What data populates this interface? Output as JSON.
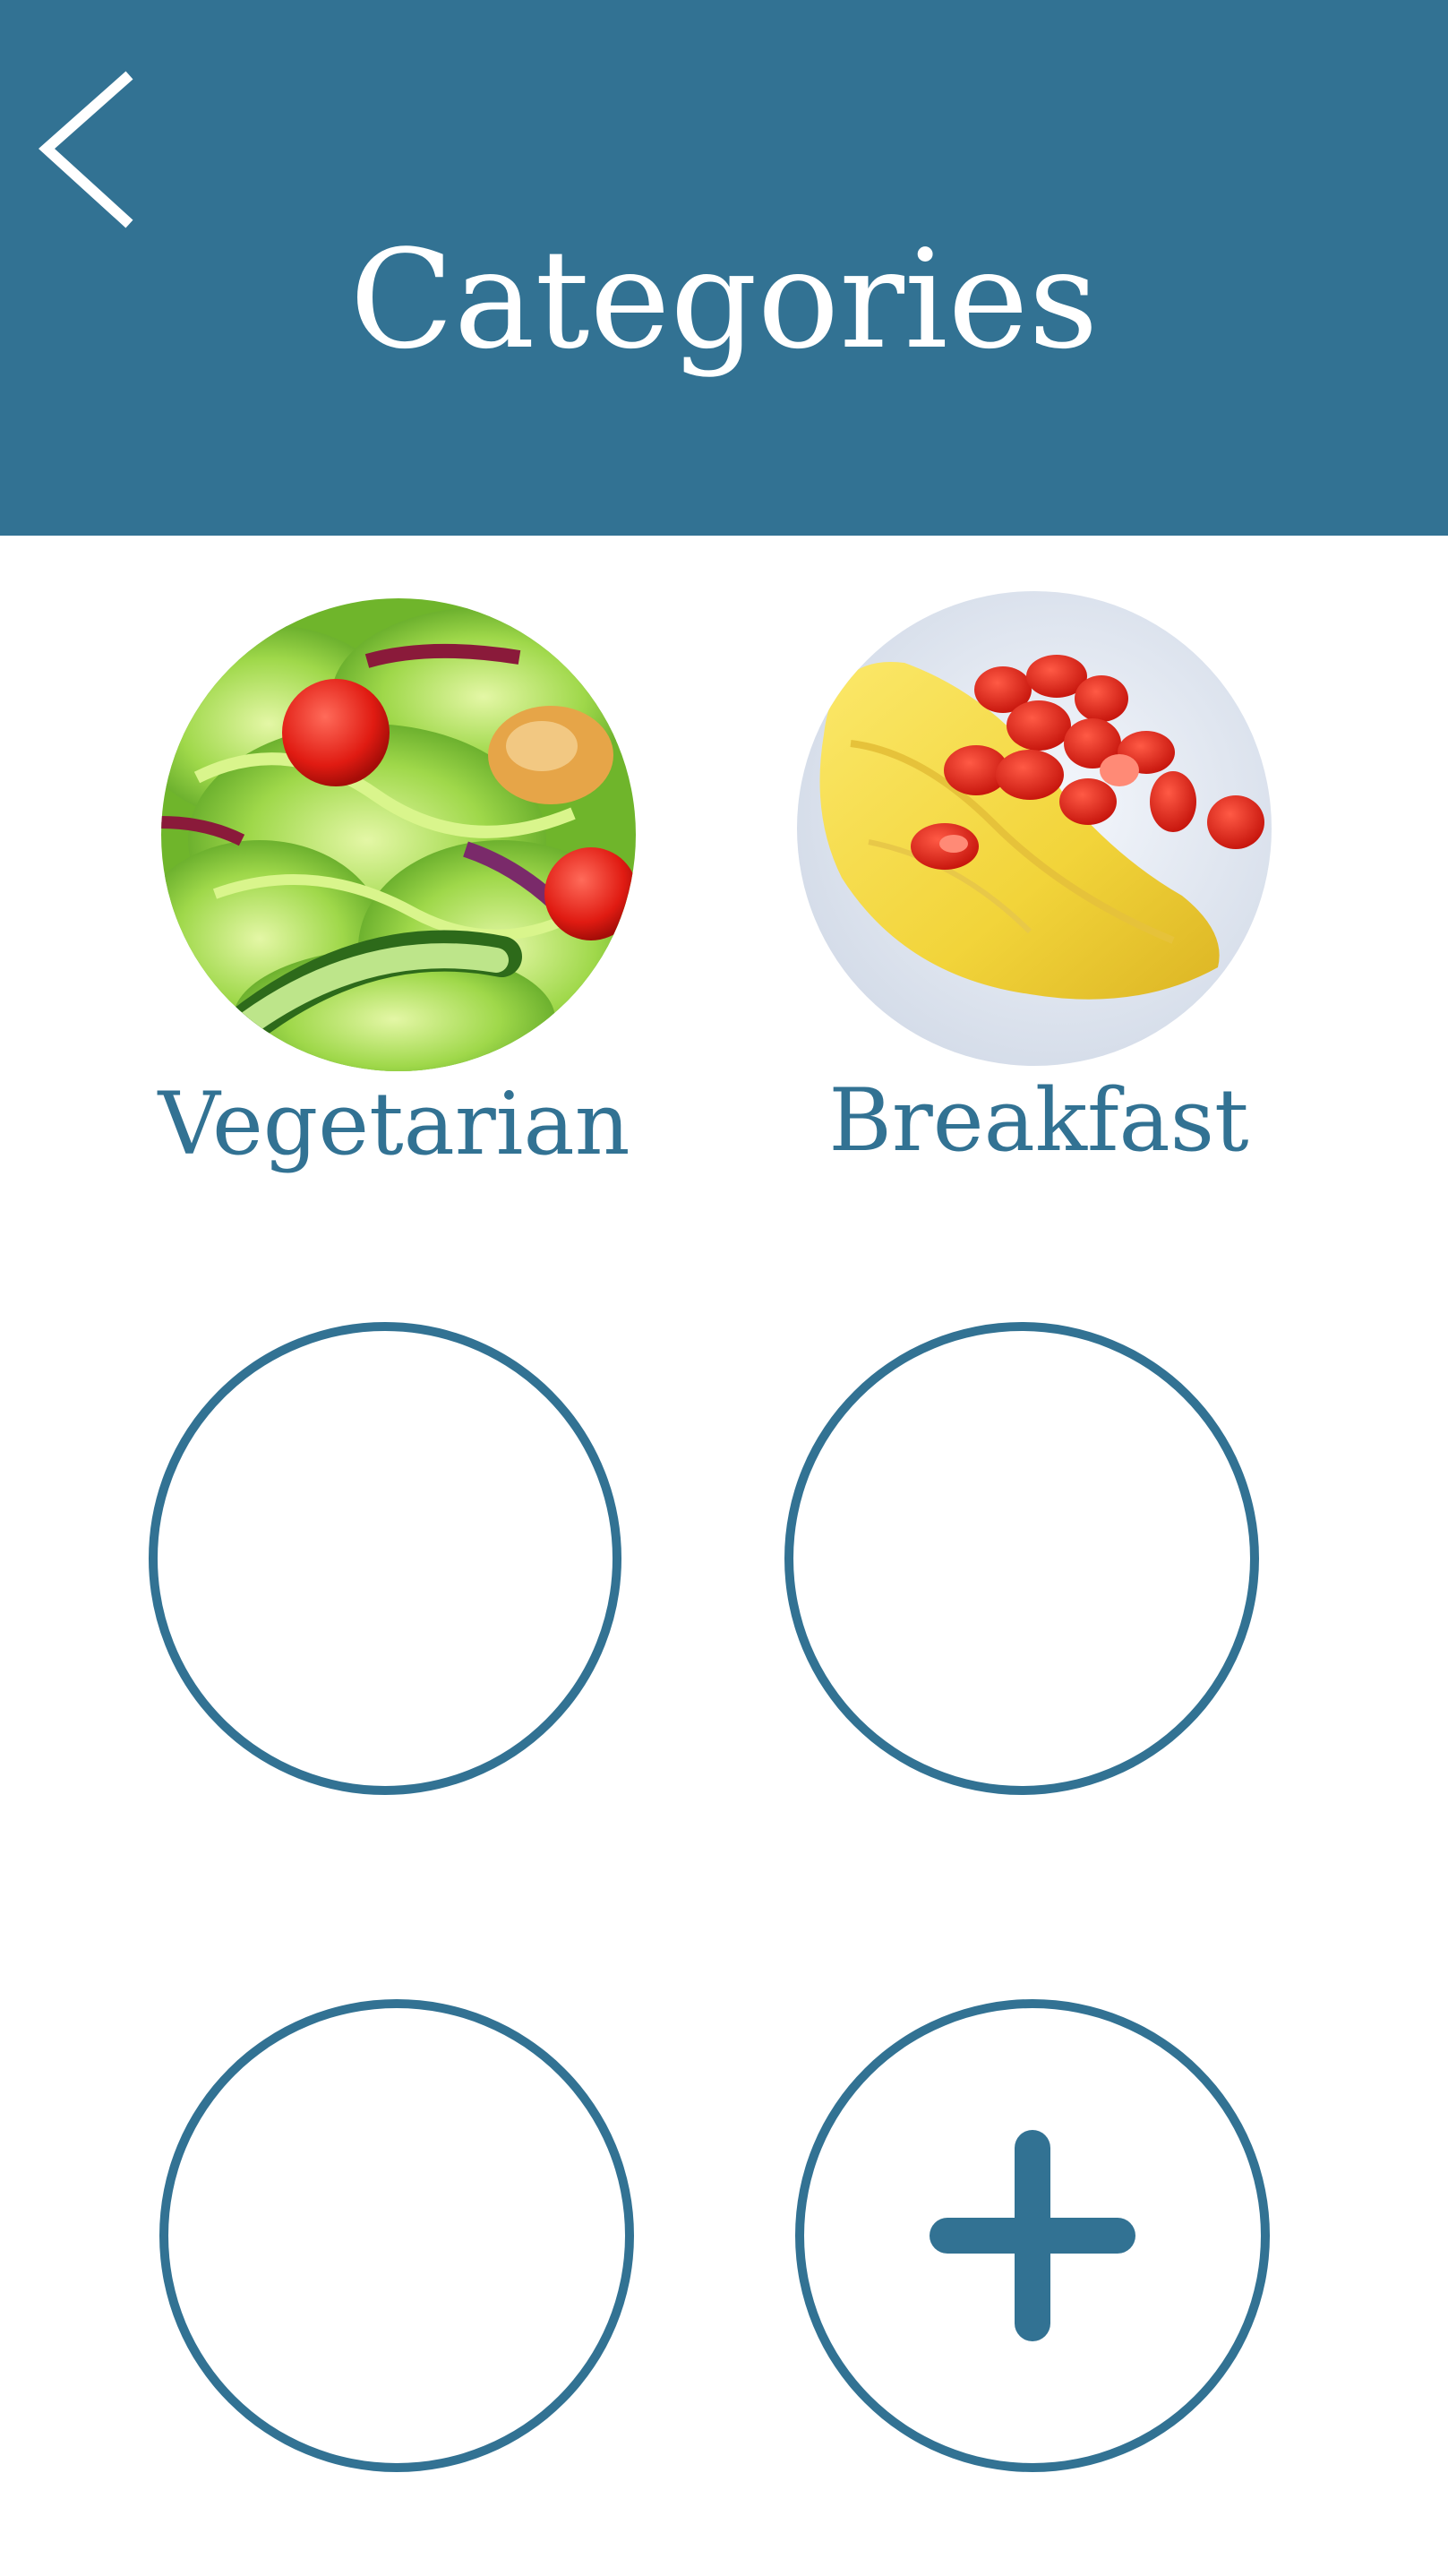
{
  "header": {
    "title": "Categories",
    "back_icon": "chevron-left-icon",
    "background_color": "#327293"
  },
  "categories": [
    {
      "label": "Vegetarian",
      "image": "salad"
    },
    {
      "label": "Breakfast",
      "image": "omelette-with-tomatoes"
    }
  ],
  "empty_slots": 3,
  "add_button": {
    "icon": "plus-icon"
  },
  "colors": {
    "accent": "#327293",
    "text_light": "#ffffff",
    "background": "#ffffff"
  }
}
